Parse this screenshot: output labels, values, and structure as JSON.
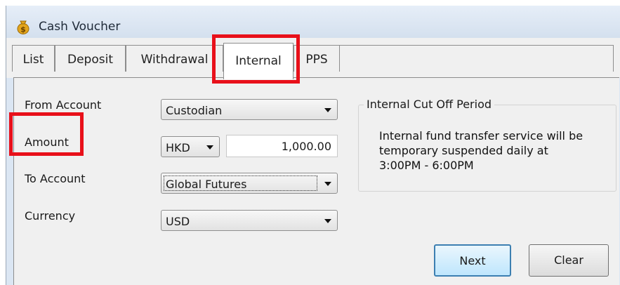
{
  "window": {
    "title": "Cash Voucher",
    "icon": "money-bag-icon"
  },
  "tabs": [
    {
      "label": "List",
      "active": false
    },
    {
      "label": "Deposit",
      "active": false
    },
    {
      "label": "Withdrawal",
      "active": false
    },
    {
      "label": "Internal",
      "active": true
    },
    {
      "label": "PPS",
      "active": false
    }
  ],
  "form": {
    "from_account_label": "From Account",
    "from_account_value": "Custodian",
    "amount_label": "Amount",
    "amount_currency": "HKD",
    "amount_value": "1,000.00",
    "to_account_label": "To Account",
    "to_account_value": "Global Futures",
    "currency_label": "Currency",
    "currency_value": "USD"
  },
  "notice": {
    "title": "Internal Cut Off Period",
    "line1": "Internal fund transfer service will be",
    "line2": "temporary suspended daily at",
    "line3": "3:00PM - 6:00PM"
  },
  "buttons": {
    "next": "Next",
    "clear": "Clear"
  },
  "colors": {
    "highlight": "#e8101a",
    "default_button_border": "#3c7fb1"
  }
}
